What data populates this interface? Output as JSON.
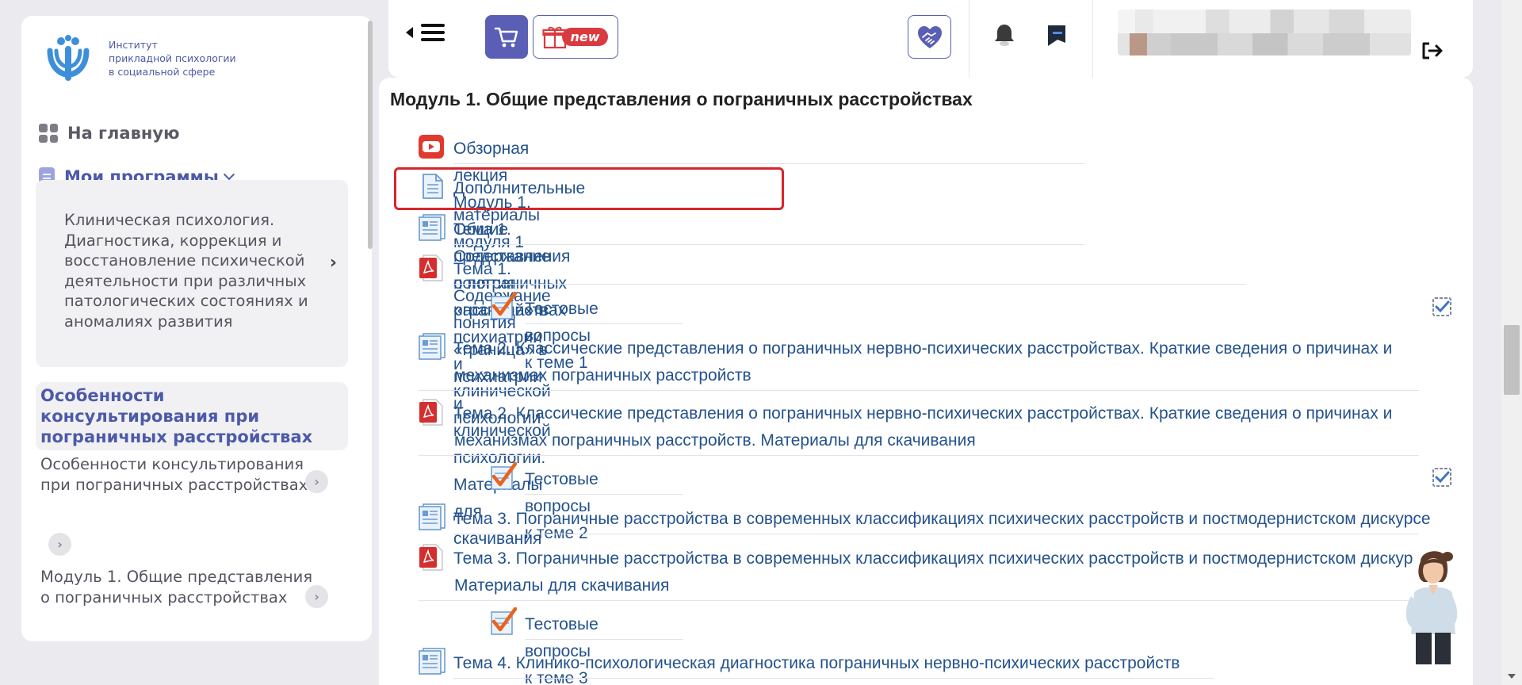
{
  "sidebar": {
    "logo_lines": [
      "Институт",
      "прикладной психологии",
      "в социальной сфере"
    ],
    "home_label": "На главную",
    "programs_label": "Мои программы",
    "program_card_text": "Клиническая психология. Диагностика, коррекция и восстановление психической деятельности при различных патологических состояниях и аномалиях развития",
    "active_course": "Особенности консультирования при пограничных расстройствах",
    "sub_items": [
      "Особенности консультирования при пограничных расстройствах",
      "Модуль 1. Общие представления о пограничных расстройствах"
    ]
  },
  "topbar": {
    "gift_badge": "new",
    "accent": "#5a5fb5"
  },
  "content": {
    "module_title": "Модуль 1. Общие представления о пограничных расстройствах",
    "items": [
      {
        "type": "video",
        "text": "Обзорная лекция Модуль 1. Общие представления о пограничных расстройствах"
      },
      {
        "type": "file",
        "text": "Дополнительные материалы модуля 1"
      },
      {
        "type": "page",
        "text": "Тема 1. Содержание понятия «граница» в психиатрии и клинической психологии"
      },
      {
        "type": "pdf",
        "text": "Тема 1. Содержание понятия «граница» в психиатрии и клинической психологии. Материалы для скачивания"
      },
      {
        "type": "quiz",
        "text": "Тестовые вопросы к теме 1"
      },
      {
        "type": "page",
        "line1": "Тема 2. Классические представления о пограничных нервно-психических расстройствах. Краткие сведения о причинах и",
        "line2": "механизмах пограничных расстройств"
      },
      {
        "type": "pdf",
        "line1": "Тема 2. Классические представления о пограничных нервно-психических расстройствах. Краткие сведения о причинах и",
        "line2": "механизмах пограничных расстройств. Материалы для скачивания"
      },
      {
        "type": "quiz",
        "text": "Тестовые вопросы к теме 2"
      },
      {
        "type": "page",
        "text": "Тема 3. Пограничные расстройства в современных классификациях психических расстройств и постмодернистском дискурсе"
      },
      {
        "type": "pdf",
        "line1": "Тема 3. Пограничные расстройства в современных классификациях психических расстройств и постмодернистском дискурсе.",
        "line2": "Материалы для скачивания"
      },
      {
        "type": "quiz",
        "text": "Тестовые вопросы к теме 3"
      },
      {
        "type": "page",
        "text": "Тема 4. Клинико-психологическая диагностика пограничных нервно-психических расстройств"
      }
    ]
  },
  "colors": {
    "link": "#24528c",
    "highlight": "#d7262b",
    "pdf": "#d32f2f",
    "quiz_check": "#e8641e"
  }
}
